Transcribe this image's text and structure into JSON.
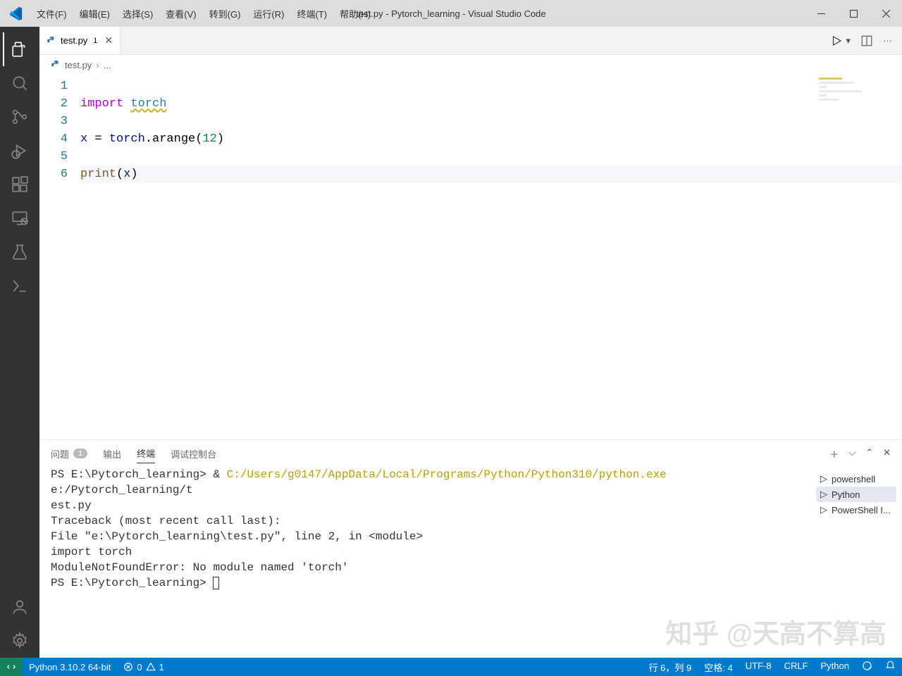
{
  "titlebar": {
    "title": "test.py - Pytorch_learning - Visual Studio Code",
    "menus": [
      "文件(F)",
      "编辑(E)",
      "选择(S)",
      "查看(V)",
      "转到(G)",
      "运行(R)",
      "终端(T)",
      "帮助(H)"
    ]
  },
  "tab": {
    "name": "test.py",
    "dirty": "1"
  },
  "breadcrumb": {
    "file": "test.py",
    "more": "..."
  },
  "code": {
    "line_numbers": [
      "1",
      "2",
      "3",
      "4",
      "5",
      "6"
    ],
    "l2_import": "import",
    "l2_torch": "torch",
    "l4_var": "x",
    "l4_eq": " = ",
    "l4_torch": "torch",
    "l4_method": ".arange(",
    "l4_num": "12",
    "l4_close": ")",
    "l6_print": "print",
    "l6_open": "(",
    "l6_var": "x",
    "l6_close": ")"
  },
  "panel": {
    "tabs": {
      "problems": "问题",
      "problems_count": "1",
      "output": "输出",
      "terminal": "终端",
      "debug": "调试控制台"
    }
  },
  "terminal": {
    "line1a": "PS E:\\Pytorch_learning> & ",
    "line1b": "C:/Users/g0147/AppData/Local/Programs/Python/Python310/python.exe",
    "line1c": " e:/Pytorch_learning/t",
    "line2": "est.py",
    "line3": "Traceback (most recent call last):",
    "line4": "  File \"e:\\Pytorch_learning\\test.py\", line 2, in <module>",
    "line5": "    import torch",
    "line6": "ModuleNotFoundError: No module named 'torch'",
    "line7": "PS E:\\Pytorch_learning> ",
    "sidebar": [
      "powershell",
      "Python",
      "PowerShell I..."
    ]
  },
  "status": {
    "python": "Python 3.10.2 64-bit",
    "errors": "0",
    "warnings": "1",
    "line_col": "行 6，列 9",
    "spaces": "空格: 4",
    "encoding": "UTF-8",
    "eol": "CRLF",
    "lang": "Python"
  },
  "watermark": "知乎  @天高不算高"
}
